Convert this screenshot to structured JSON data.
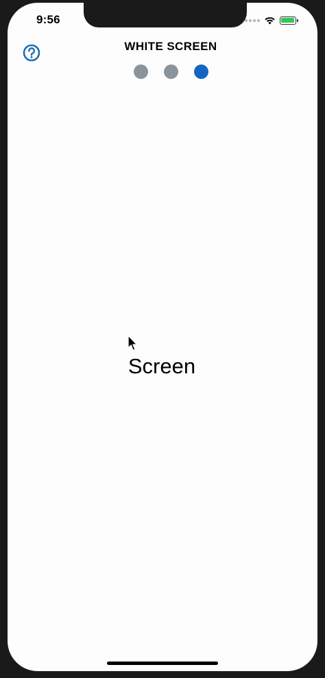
{
  "status_bar": {
    "time": "9:56",
    "wifi_icon": "wifi-icon",
    "battery_icon": "battery-charging-icon",
    "battery_color": "#35c759"
  },
  "header": {
    "title": "WHITE SCREEN",
    "help_icon": "question-circle-icon",
    "help_color": "#1f6fb2"
  },
  "pager": {
    "total": 3,
    "active_index": 2,
    "active_color": "#1565c0",
    "inactive_color": "#8a949d"
  },
  "content": {
    "label": "Screen"
  }
}
